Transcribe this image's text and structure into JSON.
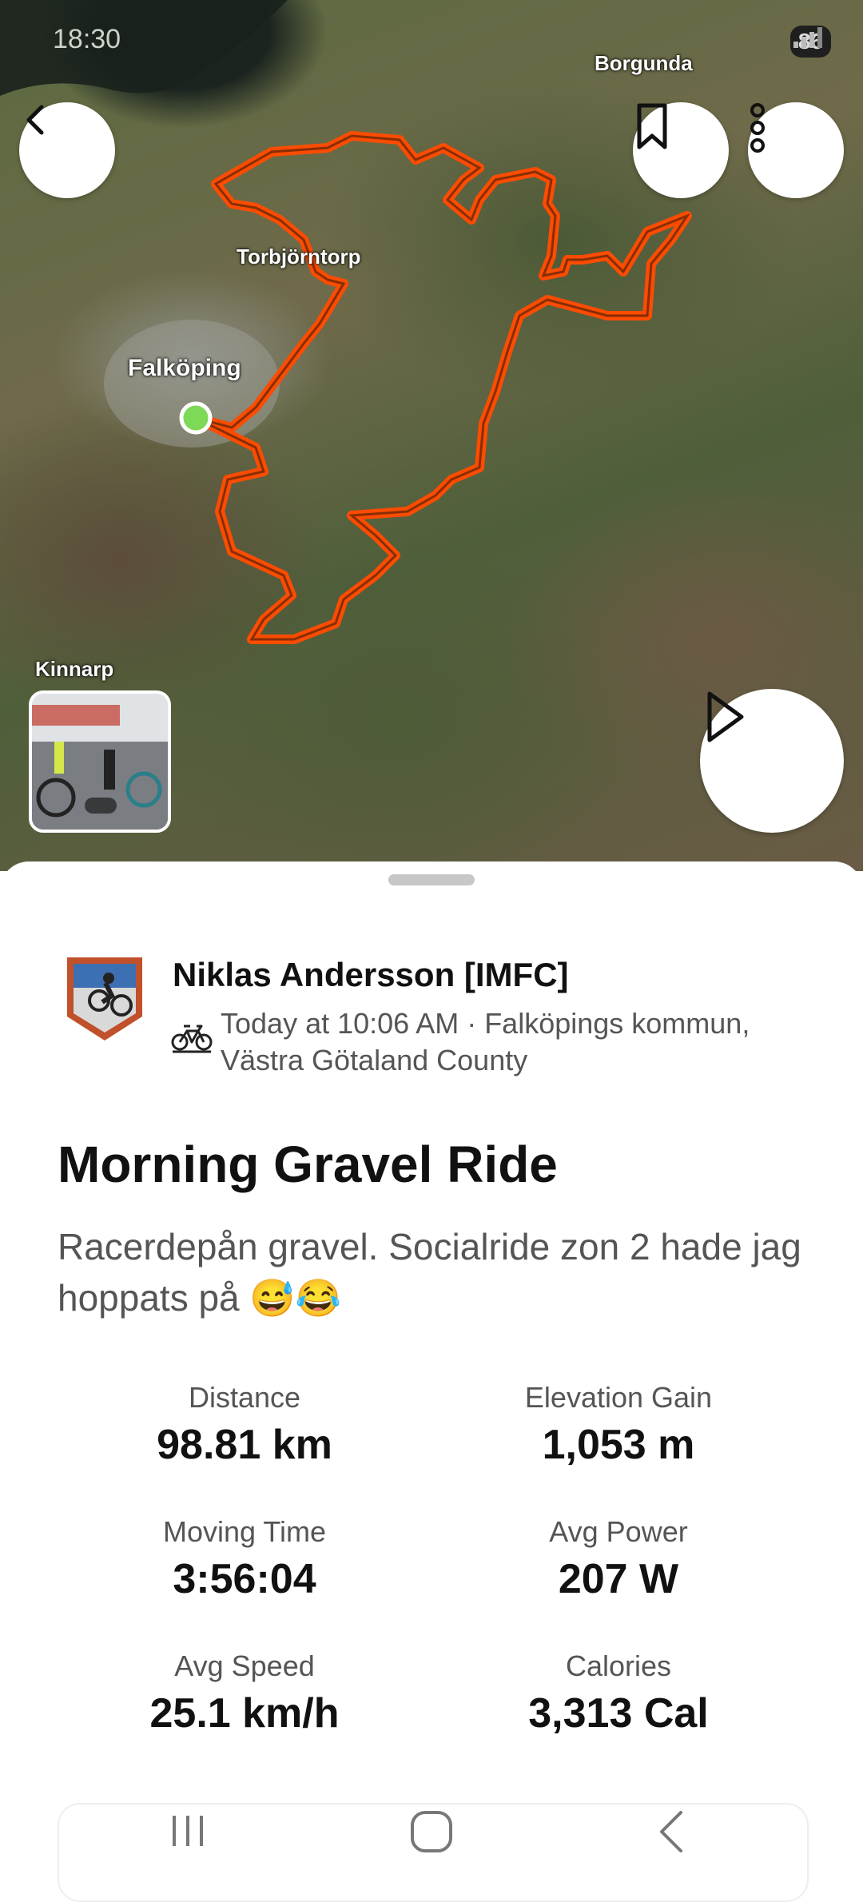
{
  "status": {
    "time": "18:30",
    "battery": "86"
  },
  "map": {
    "labels": [
      "Borgunda",
      "Torbjörntorp",
      "Falköping",
      "Kinnarp"
    ],
    "route_color": "#fc4c02",
    "start_color": "#7ed957"
  },
  "buttons": {
    "back": "back",
    "bookmark": "bookmark",
    "more": "more",
    "play": "play"
  },
  "activity": {
    "athlete_name": "Niklas Andersson [IMFC]",
    "meta_line1": "Today at 10:06 AM · Falköpings kommun,",
    "meta_line2": "Västra Götaland County",
    "title": "Morning Gravel Ride",
    "description": "Racerdepån gravel. Socialride zon 2 hade jag hoppats på 😅😂"
  },
  "stats": [
    {
      "label": "Distance",
      "value": "98.81 km"
    },
    {
      "label": "Elevation Gain",
      "value": "1,053 m"
    },
    {
      "label": "Moving Time",
      "value": "3:56:04"
    },
    {
      "label": "Avg Power",
      "value": "207 W"
    },
    {
      "label": "Avg Speed",
      "value": "25.1 km/h"
    },
    {
      "label": "Calories",
      "value": "3,313 Cal"
    }
  ],
  "colors": {
    "accent": "#fc4c02",
    "text": "#111111",
    "muted": "#555555"
  }
}
